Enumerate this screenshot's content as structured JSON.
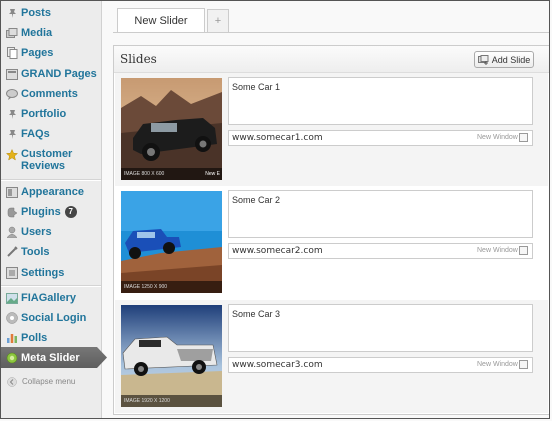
{
  "sidebar": {
    "items": [
      {
        "label": "Posts",
        "icon": "pushpin-icon"
      },
      {
        "label": "Media",
        "icon": "media-icon"
      },
      {
        "label": "Pages",
        "icon": "pages-icon"
      },
      {
        "label": "GRAND Pages",
        "icon": "grand-pages-icon"
      },
      {
        "label": "Comments",
        "icon": "comment-icon"
      },
      {
        "label": "Portfolio",
        "icon": "pushpin-icon"
      },
      {
        "label": "FAQs",
        "icon": "pushpin-icon"
      },
      {
        "label": "Customer Reviews",
        "label_line1": "Customer",
        "label_line2": "Reviews",
        "icon": "star-icon"
      },
      {
        "label": "Appearance",
        "icon": "appearance-icon"
      },
      {
        "label": "Plugins",
        "icon": "plugin-icon",
        "badge": "7"
      },
      {
        "label": "Users",
        "icon": "users-icon"
      },
      {
        "label": "Tools",
        "icon": "tools-icon"
      },
      {
        "label": "Settings",
        "icon": "settings-icon"
      },
      {
        "label": "FIAGallery",
        "icon": "gallery-icon"
      },
      {
        "label": "Social Login",
        "icon": "social-icon"
      },
      {
        "label": "Polls",
        "icon": "polls-icon"
      },
      {
        "label": "Meta Slider",
        "icon": "meta-slider-icon",
        "active": true
      }
    ],
    "collapse_label": "Collapse menu"
  },
  "tabs": {
    "active_label": "New Slider",
    "add_label": "+"
  },
  "slides_panel": {
    "title": "Slides",
    "add_button_label": "Add Slide",
    "slides": [
      {
        "caption": "Some Car 1",
        "url": "www.somecar1.com",
        "new_window_label": "New Window",
        "image_label": "IMAGE 800 X 600",
        "image_overlay": "New E"
      },
      {
        "caption": "Some Car 2",
        "url": "www.somecar2.com",
        "new_window_label": "New Window",
        "image_label": "IMAGE 1250 X 900"
      },
      {
        "caption": "Some Car 3",
        "url": "www.somecar3.com",
        "new_window_label": "New Window",
        "image_label": "IMAGE 1920 X 1200"
      }
    ]
  },
  "colors": {
    "link": "#21759b",
    "active_menu": "#6d6d6d",
    "sidebar_bg": "#ececec"
  }
}
